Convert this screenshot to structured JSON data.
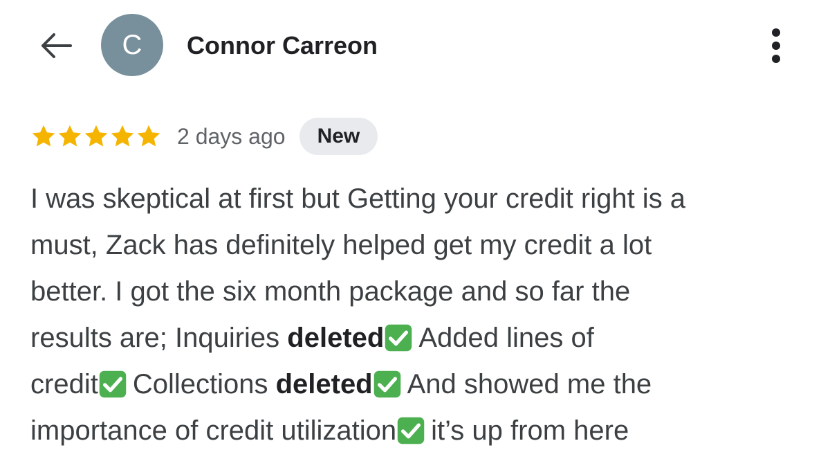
{
  "header": {
    "back_icon": "arrow-left-icon",
    "avatar_letter": "C",
    "avatar_color": "#78909c",
    "author_name": "Connor Carreon",
    "more_icon": "more-vertical-icon"
  },
  "review": {
    "rating": 5,
    "rating_max": 5,
    "star_color": "#f4b400",
    "time_ago": "2 days ago",
    "badge": "New",
    "check_icon": "white-check-mark-icon",
    "check_color": "#4caf50",
    "lines": [
      [
        {
          "t": "I was skeptical at first but Getting your credit right is a"
        }
      ],
      [
        {
          "t": "must, Zack has definitely helped get my credit a lot"
        }
      ],
      [
        {
          "t": "better. I got the six month package and so far the"
        }
      ],
      [
        {
          "t": "results are; Inquiries "
        },
        {
          "t": "deleted",
          "b": true
        },
        {
          "check": true
        },
        {
          "t": "Added lines of"
        }
      ],
      [
        {
          "t": "credit"
        },
        {
          "check": true
        },
        {
          "t": "Collections "
        },
        {
          "t": "deleted",
          "b": true
        },
        {
          "check": true
        },
        {
          "t": "And showed me the"
        }
      ],
      [
        {
          "t": "importance of credit utilization"
        },
        {
          "check": true
        },
        {
          "t": "it’s up from here"
        }
      ]
    ]
  }
}
